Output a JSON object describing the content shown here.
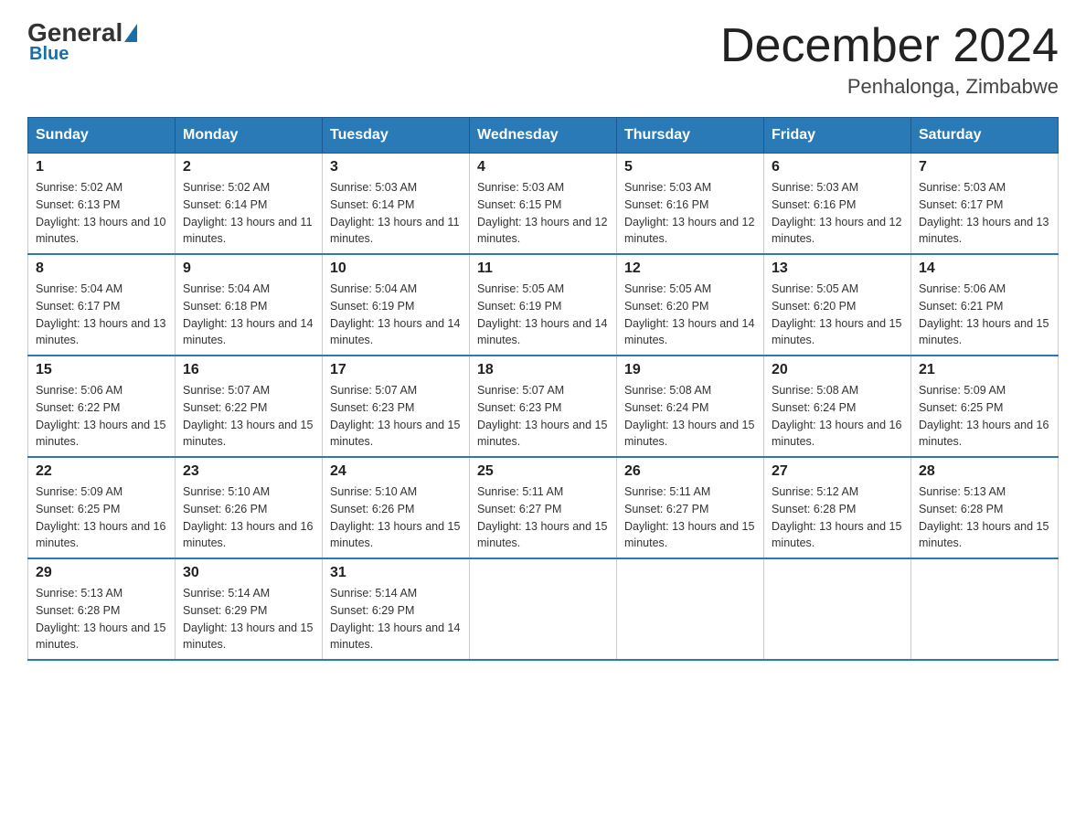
{
  "logo": {
    "general": "General",
    "blue": "Blue"
  },
  "title": {
    "month_year": "December 2024",
    "location": "Penhalonga, Zimbabwe"
  },
  "weekdays": [
    "Sunday",
    "Monday",
    "Tuesday",
    "Wednesday",
    "Thursday",
    "Friday",
    "Saturday"
  ],
  "weeks": [
    [
      {
        "day": "1",
        "sunrise": "5:02 AM",
        "sunset": "6:13 PM",
        "daylight": "13 hours and 10 minutes."
      },
      {
        "day": "2",
        "sunrise": "5:02 AM",
        "sunset": "6:14 PM",
        "daylight": "13 hours and 11 minutes."
      },
      {
        "day": "3",
        "sunrise": "5:03 AM",
        "sunset": "6:14 PM",
        "daylight": "13 hours and 11 minutes."
      },
      {
        "day": "4",
        "sunrise": "5:03 AM",
        "sunset": "6:15 PM",
        "daylight": "13 hours and 12 minutes."
      },
      {
        "day": "5",
        "sunrise": "5:03 AM",
        "sunset": "6:16 PM",
        "daylight": "13 hours and 12 minutes."
      },
      {
        "day": "6",
        "sunrise": "5:03 AM",
        "sunset": "6:16 PM",
        "daylight": "13 hours and 12 minutes."
      },
      {
        "day": "7",
        "sunrise": "5:03 AM",
        "sunset": "6:17 PM",
        "daylight": "13 hours and 13 minutes."
      }
    ],
    [
      {
        "day": "8",
        "sunrise": "5:04 AM",
        "sunset": "6:17 PM",
        "daylight": "13 hours and 13 minutes."
      },
      {
        "day": "9",
        "sunrise": "5:04 AM",
        "sunset": "6:18 PM",
        "daylight": "13 hours and 14 minutes."
      },
      {
        "day": "10",
        "sunrise": "5:04 AM",
        "sunset": "6:19 PM",
        "daylight": "13 hours and 14 minutes."
      },
      {
        "day": "11",
        "sunrise": "5:05 AM",
        "sunset": "6:19 PM",
        "daylight": "13 hours and 14 minutes."
      },
      {
        "day": "12",
        "sunrise": "5:05 AM",
        "sunset": "6:20 PM",
        "daylight": "13 hours and 14 minutes."
      },
      {
        "day": "13",
        "sunrise": "5:05 AM",
        "sunset": "6:20 PM",
        "daylight": "13 hours and 15 minutes."
      },
      {
        "day": "14",
        "sunrise": "5:06 AM",
        "sunset": "6:21 PM",
        "daylight": "13 hours and 15 minutes."
      }
    ],
    [
      {
        "day": "15",
        "sunrise": "5:06 AM",
        "sunset": "6:22 PM",
        "daylight": "13 hours and 15 minutes."
      },
      {
        "day": "16",
        "sunrise": "5:07 AM",
        "sunset": "6:22 PM",
        "daylight": "13 hours and 15 minutes."
      },
      {
        "day": "17",
        "sunrise": "5:07 AM",
        "sunset": "6:23 PM",
        "daylight": "13 hours and 15 minutes."
      },
      {
        "day": "18",
        "sunrise": "5:07 AM",
        "sunset": "6:23 PM",
        "daylight": "13 hours and 15 minutes."
      },
      {
        "day": "19",
        "sunrise": "5:08 AM",
        "sunset": "6:24 PM",
        "daylight": "13 hours and 15 minutes."
      },
      {
        "day": "20",
        "sunrise": "5:08 AM",
        "sunset": "6:24 PM",
        "daylight": "13 hours and 16 minutes."
      },
      {
        "day": "21",
        "sunrise": "5:09 AM",
        "sunset": "6:25 PM",
        "daylight": "13 hours and 16 minutes."
      }
    ],
    [
      {
        "day": "22",
        "sunrise": "5:09 AM",
        "sunset": "6:25 PM",
        "daylight": "13 hours and 16 minutes."
      },
      {
        "day": "23",
        "sunrise": "5:10 AM",
        "sunset": "6:26 PM",
        "daylight": "13 hours and 16 minutes."
      },
      {
        "day": "24",
        "sunrise": "5:10 AM",
        "sunset": "6:26 PM",
        "daylight": "13 hours and 15 minutes."
      },
      {
        "day": "25",
        "sunrise": "5:11 AM",
        "sunset": "6:27 PM",
        "daylight": "13 hours and 15 minutes."
      },
      {
        "day": "26",
        "sunrise": "5:11 AM",
        "sunset": "6:27 PM",
        "daylight": "13 hours and 15 minutes."
      },
      {
        "day": "27",
        "sunrise": "5:12 AM",
        "sunset": "6:28 PM",
        "daylight": "13 hours and 15 minutes."
      },
      {
        "day": "28",
        "sunrise": "5:13 AM",
        "sunset": "6:28 PM",
        "daylight": "13 hours and 15 minutes."
      }
    ],
    [
      {
        "day": "29",
        "sunrise": "5:13 AM",
        "sunset": "6:28 PM",
        "daylight": "13 hours and 15 minutes."
      },
      {
        "day": "30",
        "sunrise": "5:14 AM",
        "sunset": "6:29 PM",
        "daylight": "13 hours and 15 minutes."
      },
      {
        "day": "31",
        "sunrise": "5:14 AM",
        "sunset": "6:29 PM",
        "daylight": "13 hours and 14 minutes."
      },
      null,
      null,
      null,
      null
    ]
  ]
}
